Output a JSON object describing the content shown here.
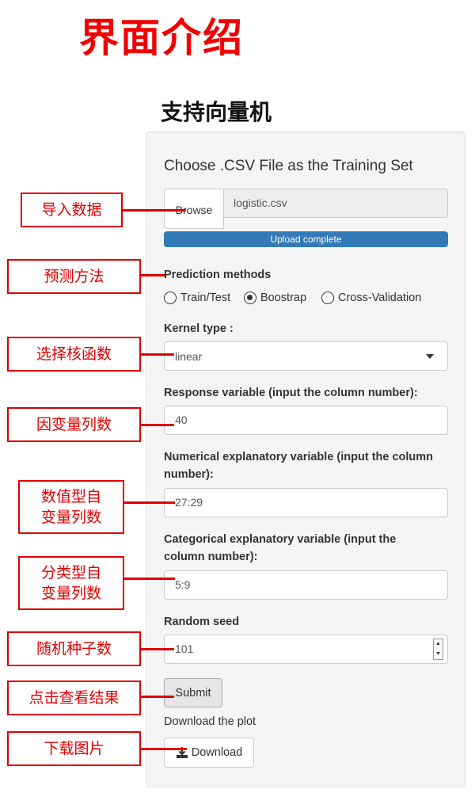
{
  "page": {
    "title": "界面介绍"
  },
  "app": {
    "title": "支持向量机"
  },
  "file": {
    "heading": "Choose .CSV File as the Training Set",
    "browse_label": "Browse",
    "file_name": "logistic.csv",
    "progress_text": "Upload complete",
    "progress_fraction": 1.0
  },
  "prediction": {
    "label": "Prediction methods",
    "options": [
      "Train/Test",
      "Boostrap",
      "Cross-Validation"
    ],
    "selected": "Boostrap"
  },
  "kernel": {
    "label": "Kernel type :",
    "value": "linear"
  },
  "response": {
    "label": "Response variable (input the column number):",
    "value": "40"
  },
  "numerical": {
    "label_line1": "Numerical explanatory variable (input the column",
    "label_line2": "number):",
    "value": "27:29"
  },
  "categorical": {
    "label_line1": "Categorical explanatory variable (input the",
    "label_line2": "column number):",
    "value": "5:9"
  },
  "seed": {
    "label": "Random seed",
    "value": "101"
  },
  "submit": {
    "label": "Submit"
  },
  "download": {
    "caption": "Download the plot",
    "button_label": "Download",
    "icon": "download-icon"
  },
  "annotations": {
    "import_data": "导入数据",
    "prediction_method": "预测方法",
    "kernel": "选择核函数",
    "response": "因变量列数",
    "numerical_1": "数值型自",
    "numerical_2": "变量列数",
    "categorical_1": "分类型自",
    "categorical_2": "变量列数",
    "seed": "随机种子数",
    "submit": "点击查看结果",
    "download": "下载图片"
  },
  "colors": {
    "annotation": "#e00000",
    "progress": "#337ab7",
    "title": "#f00000"
  }
}
